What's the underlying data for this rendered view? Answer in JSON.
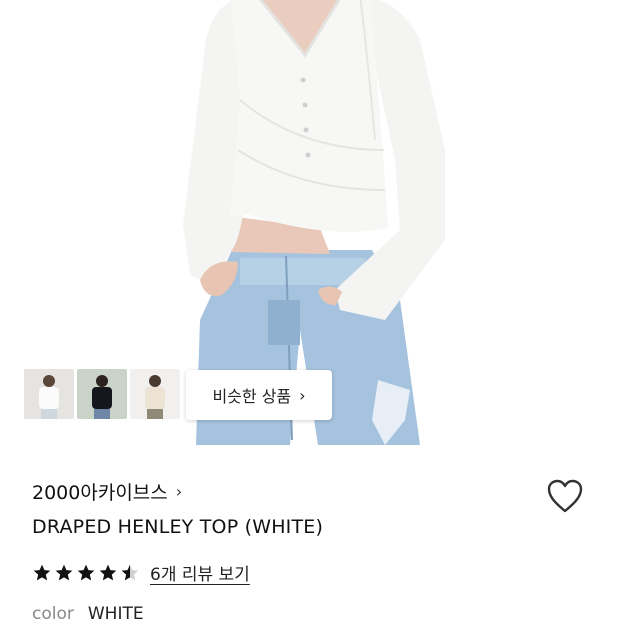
{
  "hero": {
    "similar_button_label": "비슷한 상품",
    "thumbnails": [
      "thumbnail-white-top",
      "thumbnail-black-top",
      "thumbnail-beige-top"
    ]
  },
  "product": {
    "brand": "2000아카이브스",
    "title": "DRAPED HENLEY TOP (WHITE)",
    "rating": 4.5,
    "rating_max": 5,
    "review_link": "6개 리뷰 보기",
    "option_label": "color",
    "option_value": "WHITE"
  },
  "colors": {
    "star": "#111111",
    "denim": "#9fc0dc",
    "top": "#f6f6f4"
  },
  "icons": {
    "heart": "heart-icon",
    "brand_chevron": "chevron-right-icon",
    "button_chevron": "chevron-right-icon"
  }
}
